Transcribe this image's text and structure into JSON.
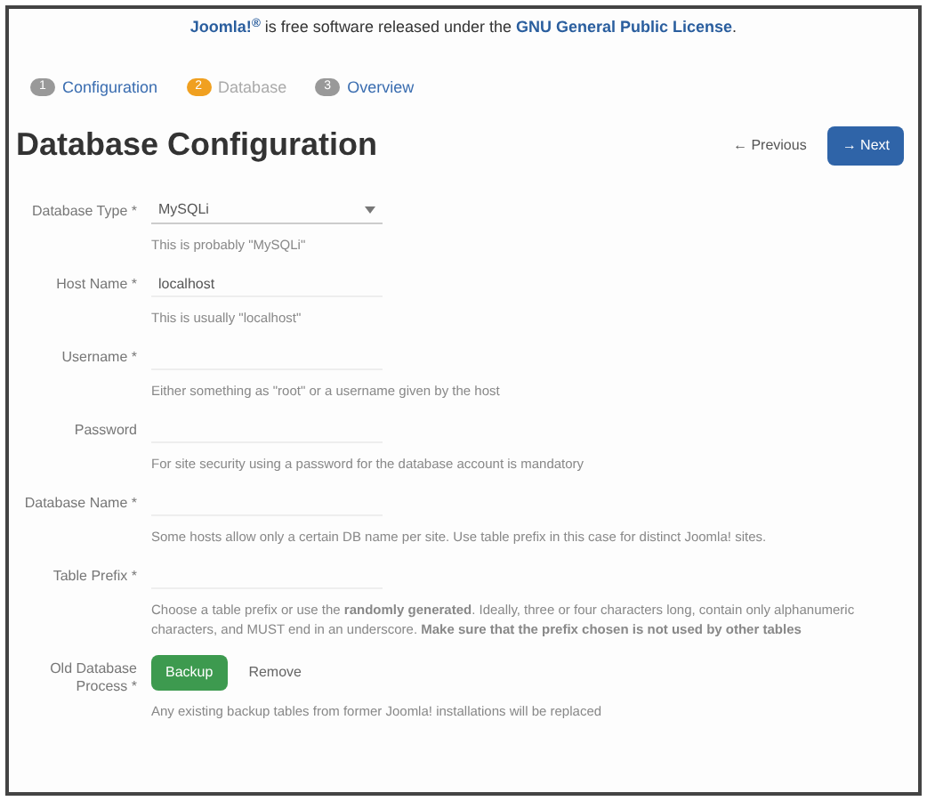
{
  "notice": {
    "brand": "Joomla!",
    "sup": "®",
    "text": " is free software released under the ",
    "link": "GNU General Public License",
    "end": "."
  },
  "steps": [
    {
      "number": "1",
      "label": "Configuration",
      "selected": false
    },
    {
      "number": "2",
      "label": "Database",
      "selected": true
    },
    {
      "number": "3",
      "label": "Overview",
      "selected": false
    }
  ],
  "title": "Database Configuration",
  "buttons": [
    {
      "label": "Previous",
      "icon": "←",
      "kind": "plain"
    },
    {
      "label": "Next",
      "icon": "→",
      "kind": "primary"
    }
  ],
  "fields": [
    {
      "kind": "select",
      "label": "Database Type *",
      "value": "MySQLi",
      "help": "This is probably \"MySQLi\""
    },
    {
      "kind": "input",
      "label": "Host Name *",
      "value": "localhost",
      "help": "This is usually \"localhost\""
    },
    {
      "kind": "input",
      "label": "Username *",
      "help": "Either something as \"root\" or a username given by the host"
    },
    {
      "kind": "input",
      "label": "Password",
      "help": "For site security using a password for the database account is mandatory"
    },
    {
      "kind": "input",
      "label": "Database Name *",
      "help": "Some hosts allow only a certain DB name per site. Use table prefix in this case for distinct Joomla! sites."
    },
    {
      "kind": "input",
      "label": "Table Prefix *",
      "help": "Choose a table prefix or use the **randomly generated**. Ideally, three or four characters long, contain only alphanumeric characters, and MUST end in an underscore. **Make sure that the prefix chosen is not used by other tables**"
    },
    {
      "kind": "toggle",
      "label": "Old Database Process *",
      "options": [
        {
          "label": "Backup",
          "selected": true
        },
        {
          "label": "Remove",
          "selected": false
        }
      ],
      "help": "Any existing backup tables from former Joomla! installations will be replaced"
    }
  ]
}
